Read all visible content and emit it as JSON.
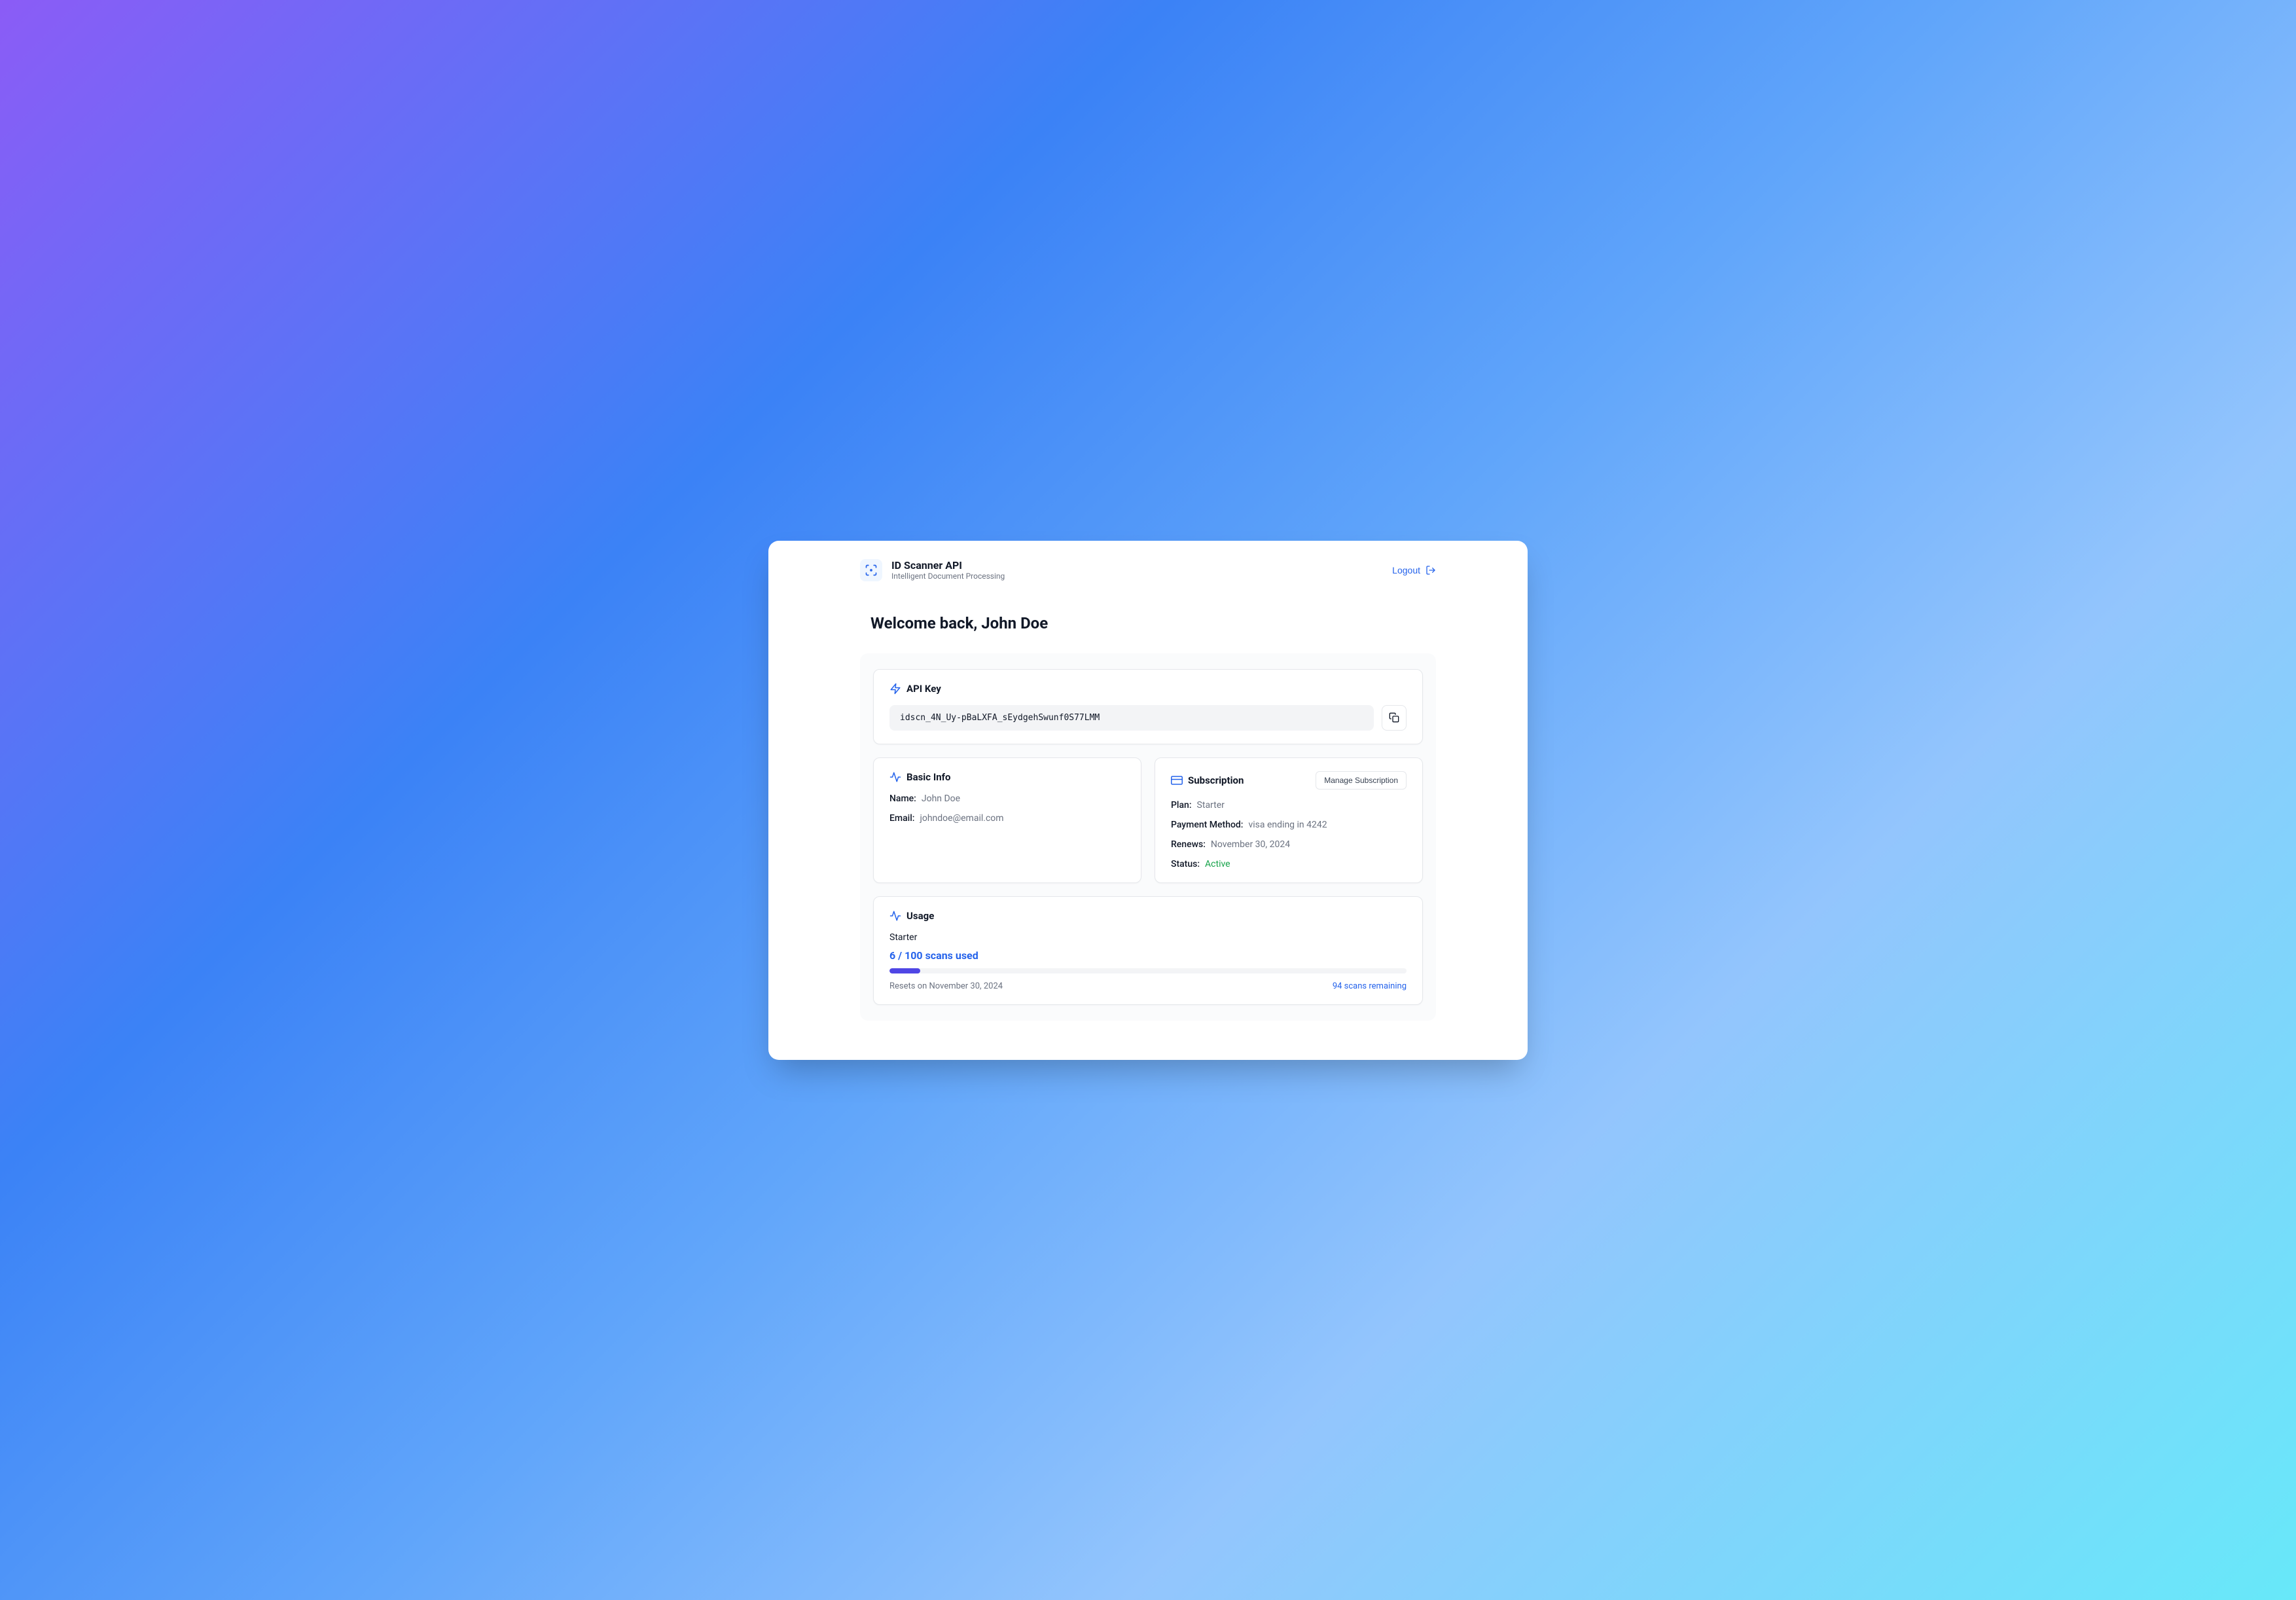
{
  "brand": {
    "title": "ID Scanner API",
    "subtitle": "Intelligent Document Processing"
  },
  "header": {
    "logout_label": "Logout"
  },
  "welcome_heading": "Welcome back, John Doe",
  "api_key_card": {
    "title": "API Key",
    "value": "idscn_4N_Uy-pBaLXFA_sEydgehSwunf0S77LMM"
  },
  "basic_info_card": {
    "title": "Basic Info",
    "name_label": "Name:",
    "name_value": "John Doe",
    "email_label": "Email:",
    "email_value": "johndoe@email.com"
  },
  "subscription_card": {
    "title": "Subscription",
    "manage_label": "Manage Subscription",
    "plan_label": "Plan:",
    "plan_value": "Starter",
    "payment_label": "Payment Method:",
    "payment_value": "visa ending in 4242",
    "renews_label": "Renews:",
    "renews_value": "November 30, 2024",
    "status_label": "Status:",
    "status_value": "Active"
  },
  "usage_card": {
    "title": "Usage",
    "plan": "Starter",
    "count_text": "6 / 100 scans used",
    "progress_percent": 6,
    "reset_text": "Resets on November 30, 2024",
    "remaining_text": "94 scans remaining"
  }
}
